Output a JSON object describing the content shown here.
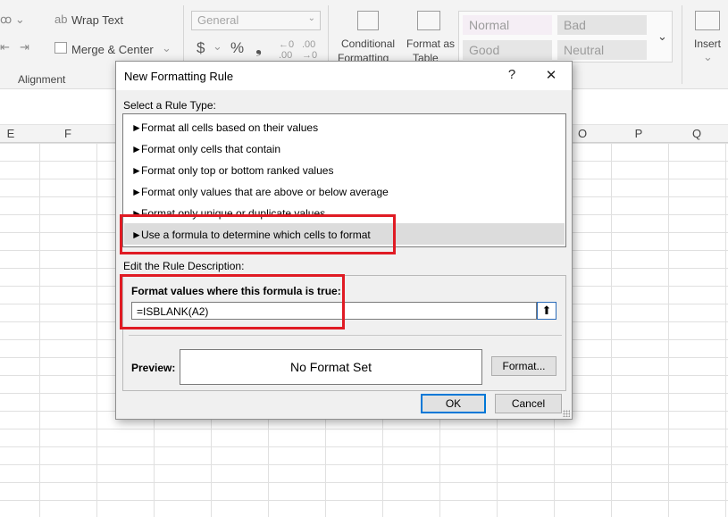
{
  "ribbon": {
    "wrap_text": "Wrap Text",
    "merge_center": "Merge & Center",
    "alignment_group": "Alignment",
    "number_format": "General",
    "currency_symbol": "$",
    "percent_symbol": "%",
    "comma_symbol": "❟",
    "conditional_formatting_line1": "Conditional",
    "conditional_formatting_line2": "Formatting",
    "format_as_table_line1": "Format as",
    "format_as_table_line2": "Table",
    "insert": "Insert",
    "styles": [
      {
        "label": "Normal",
        "bg": "#f5eef5"
      },
      {
        "label": "Bad",
        "bg": "#e4e4e4"
      },
      {
        "label": "Good",
        "bg": "#e6e6e6"
      },
      {
        "label": "Neutral",
        "bg": "#e6e6e6"
      }
    ]
  },
  "sheet": {
    "columns": [
      "E",
      "F",
      "O",
      "P",
      "Q"
    ]
  },
  "dialog": {
    "title": "New Formatting Rule",
    "help_symbol": "?",
    "close_symbol": "✕",
    "rule_type_label": "Select a Rule Type:",
    "rule_types": [
      "Format all cells based on their values",
      "Format only cells that contain",
      "Format only top or bottom ranked values",
      "Format only values that are above or below average",
      "Format only unique or duplicate values",
      "Use a formula to determine which cells to format"
    ],
    "selected_rule_index": 5,
    "description_label": "Edit the Rule Description:",
    "formula_label": "Format values where this formula is true:",
    "formula_value": "=ISBLANK(A2)",
    "preview_label": "Preview:",
    "preview_text": "No Format Set",
    "format_button": "Format...",
    "ok_button": "OK",
    "cancel_button": "Cancel"
  },
  "colors": {
    "highlight": "#e01b24",
    "selection": "#dcdcdc",
    "accent": "#0078d7"
  }
}
